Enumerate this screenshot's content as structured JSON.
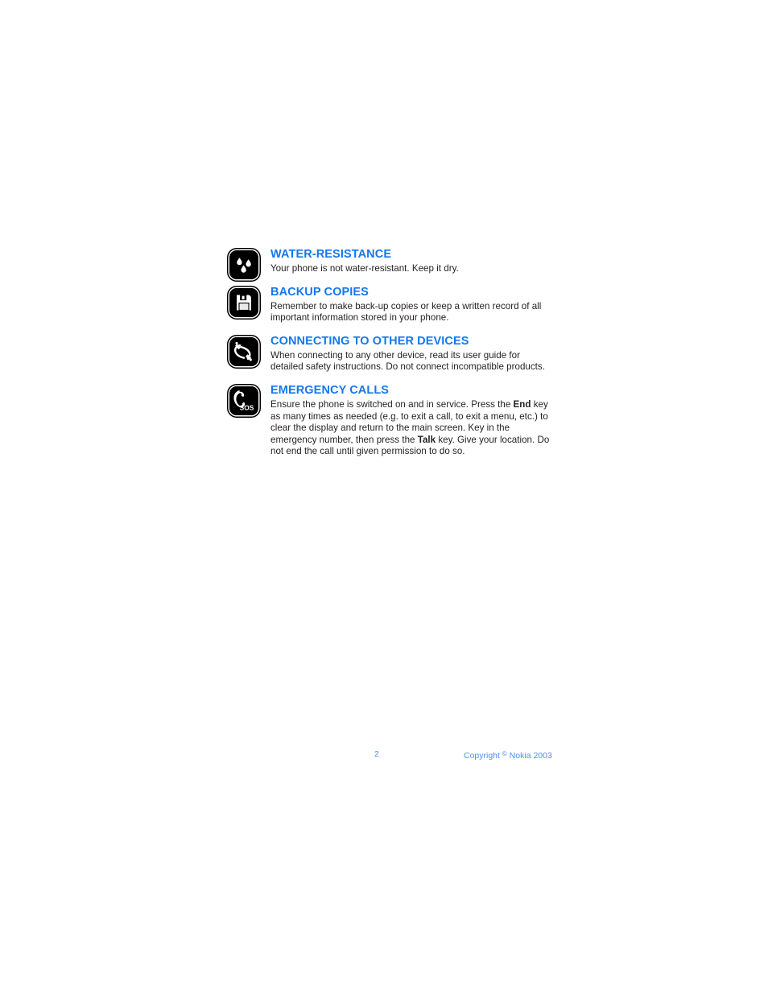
{
  "document": {
    "page_number": "2",
    "copyright_prefix": "Copyright ",
    "copyright_symbol": "©",
    "copyright_suffix": " Nokia 2003",
    "heading_color": "#1378ed",
    "body_color": "#231f20",
    "footer_color": "#4d91ef",
    "icon_color": "#000000"
  },
  "safety_items": [
    {
      "icon": "water-drops-icon",
      "heading": "WATER-RESISTANCE",
      "body_before": "Your phone is not water-resistant. Keep it dry.",
      "bold1": "",
      "body_middle": "",
      "bold2": "",
      "body_after": ""
    },
    {
      "icon": "floppy-disk-icon",
      "heading": "BACKUP COPIES",
      "body_before": "Remember to make back-up copies or keep a written record of all important information stored in your phone.",
      "bold1": "",
      "body_middle": "",
      "bold2": "",
      "body_after": ""
    },
    {
      "icon": "connectors-plugs-icon",
      "heading": "CONNECTING TO OTHER DEVICES",
      "body_before": "When connecting to any other device, read its user guide for detailed safety instructions. Do not connect incompatible products.",
      "bold1": "",
      "body_middle": "",
      "bold2": "",
      "body_after": ""
    },
    {
      "icon": "emergency-sos-phone-icon",
      "heading": "EMERGENCY CALLS",
      "body_before": "Ensure the phone is switched on and in service. Press the ",
      "bold1": "End",
      "body_middle": " key as many times as needed (e.g. to exit a call, to exit a menu, etc.) to clear the display and return to the main screen. Key in the emergency number, then press the ",
      "bold2": "Talk",
      "body_after": " key. Give your location. Do not end the call until given permission to do so."
    }
  ]
}
